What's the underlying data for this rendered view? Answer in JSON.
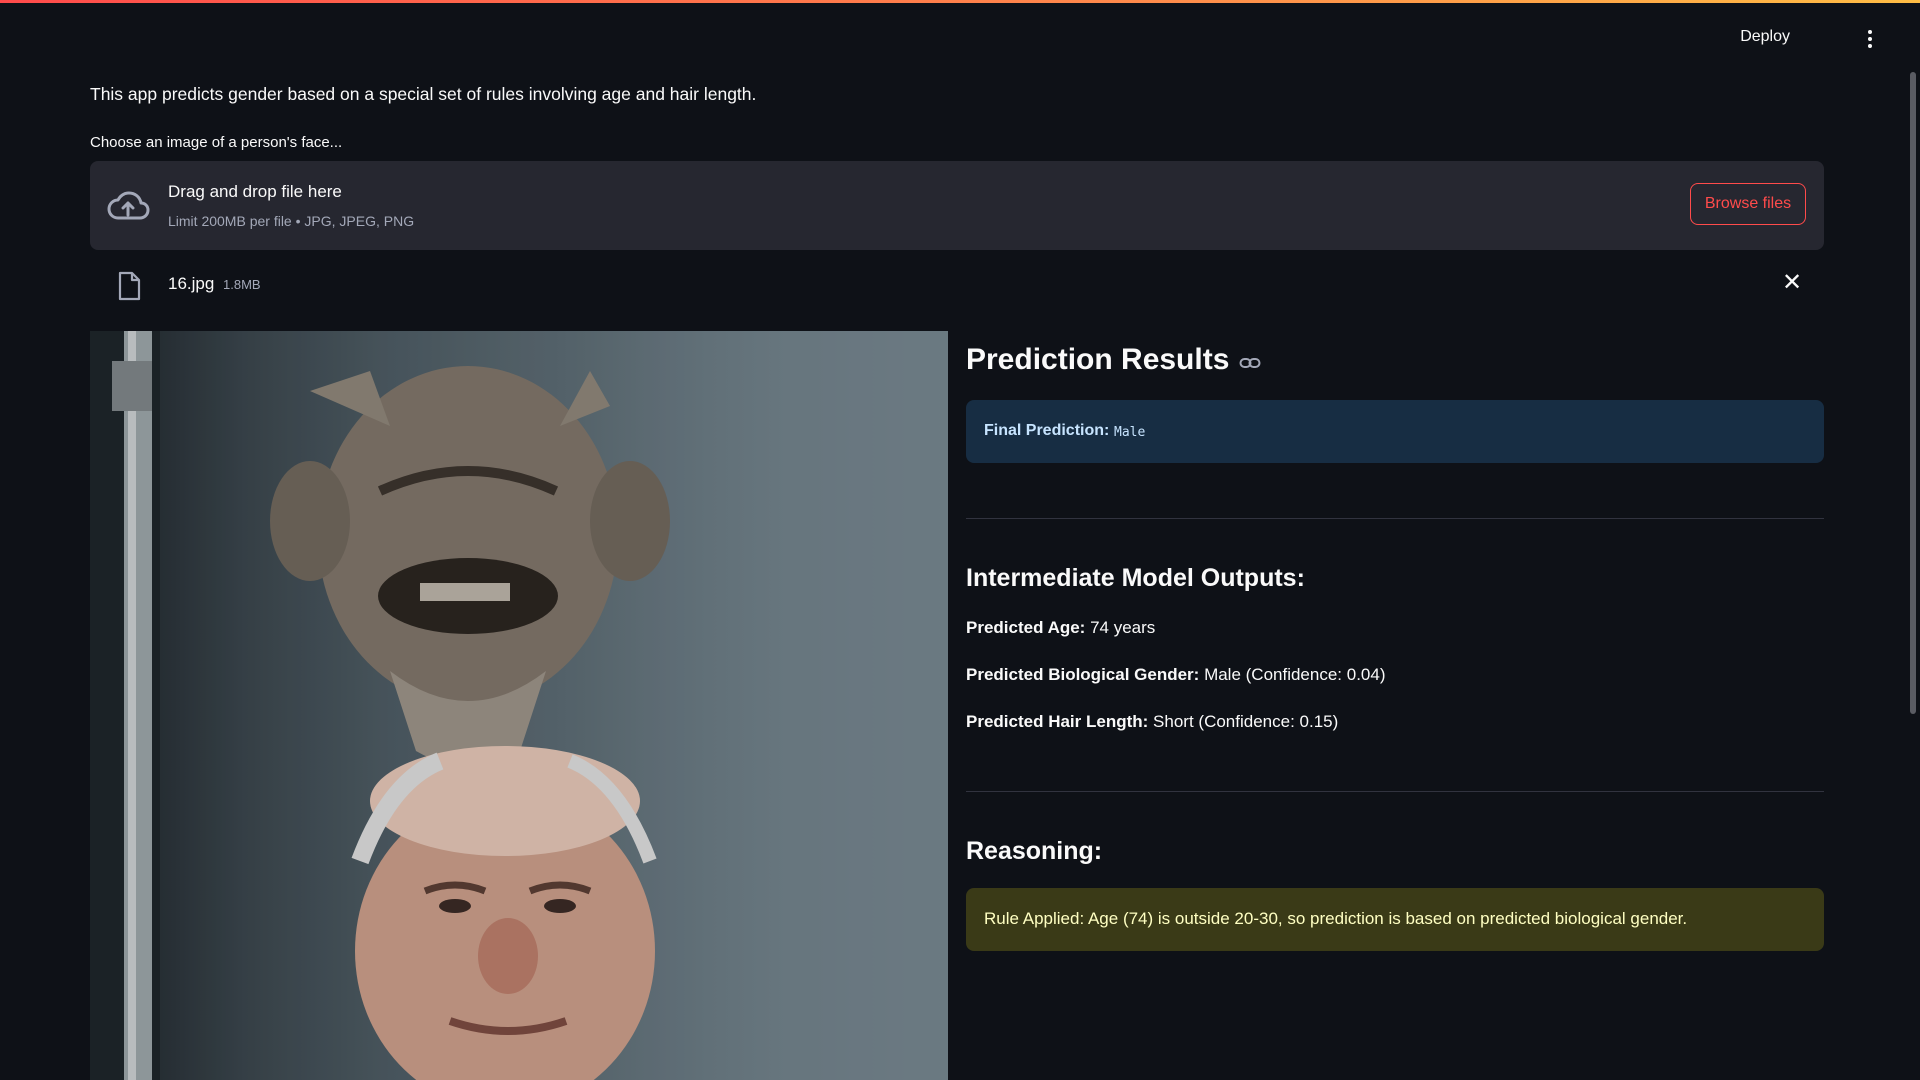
{
  "header": {
    "deploy_label": "Deploy",
    "menu_icon": "vertical-dots-icon"
  },
  "intro": {
    "text": "This app predicts gender based on a special set of rules involving age and hair length."
  },
  "uploader": {
    "label": "Choose an image of a person's face...",
    "drop_title": "Drag and drop file here",
    "drop_subtitle": "Limit 200MB per file • JPG, JPEG, PNG",
    "browse_label": "Browse files",
    "accent_color": "#ff4b4b"
  },
  "file": {
    "name": "16.jpg",
    "size": "1.8MB",
    "remove_icon": "✕"
  },
  "results": {
    "title": "Prediction Results",
    "final_label": "Final Prediction:",
    "final_value": "Male",
    "intermediate_title": "Intermediate Model Outputs:",
    "age_label": "Predicted Age:",
    "age_value": "74 years",
    "gender_label": "Predicted Biological Gender:",
    "gender_value": "Male (Confidence: 0.04)",
    "hair_label": "Predicted Hair Length:",
    "hair_value": "Short (Confidence: 0.15)",
    "reasoning_title": "Reasoning:",
    "reasoning_text": "Rule Applied: Age (74) is outside 20-30, so prediction is based on predicted biological gender."
  }
}
